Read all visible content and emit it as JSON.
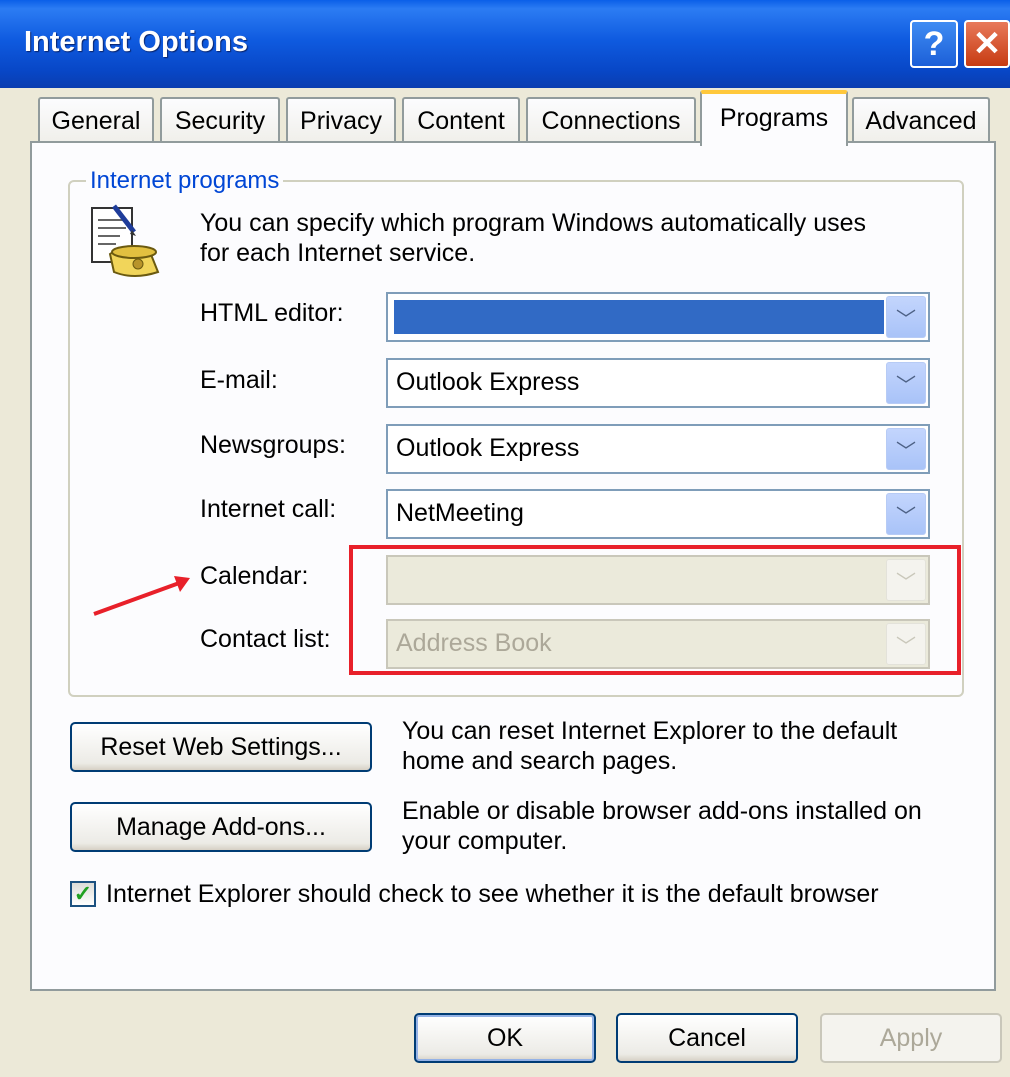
{
  "window": {
    "title": "Internet Options",
    "help_glyph": "?",
    "close_glyph": "✕"
  },
  "tabs": [
    {
      "label": "General"
    },
    {
      "label": "Security"
    },
    {
      "label": "Privacy"
    },
    {
      "label": "Content"
    },
    {
      "label": "Connections"
    },
    {
      "label": "Programs",
      "active": true
    },
    {
      "label": "Advanced"
    }
  ],
  "internet_programs": {
    "group_label": "Internet programs",
    "description_line1": "You can specify which program Windows automatically uses",
    "description_line2": "for each Internet service.",
    "icon": "phone-document-icon",
    "fields": [
      {
        "label": "HTML editor:",
        "value": "",
        "highlighted": true,
        "enabled": true
      },
      {
        "label": "E-mail:",
        "value": "Outlook Express",
        "enabled": true
      },
      {
        "label": "Newsgroups:",
        "value": "Outlook Express",
        "enabled": true
      },
      {
        "label": "Internet call:",
        "value": "NetMeeting",
        "enabled": true
      },
      {
        "label": "Calendar:",
        "value": "",
        "enabled": false
      },
      {
        "label": "Contact list:",
        "value": "Address Book",
        "enabled": false
      }
    ],
    "dropdown_glyph": "﹀"
  },
  "reset": {
    "button_label": "Reset Web Settings...",
    "description_line1": "You can reset Internet Explorer to the default",
    "description_line2": "home and search pages."
  },
  "addons": {
    "button_label": "Manage Add-ons...",
    "description_line1": "Enable or disable browser add-ons installed on",
    "description_line2": "your computer."
  },
  "default_check": {
    "checked": true,
    "check_glyph": "✓",
    "label": "Internet Explorer should check to see whether it is the default browser"
  },
  "footer": {
    "ok_label": "OK",
    "cancel_label": "Cancel",
    "apply_label": "Apply"
  },
  "colors": {
    "annotation": "#E8202A",
    "titlebar": "#0A5FE8",
    "group_label": "#0046D5"
  }
}
